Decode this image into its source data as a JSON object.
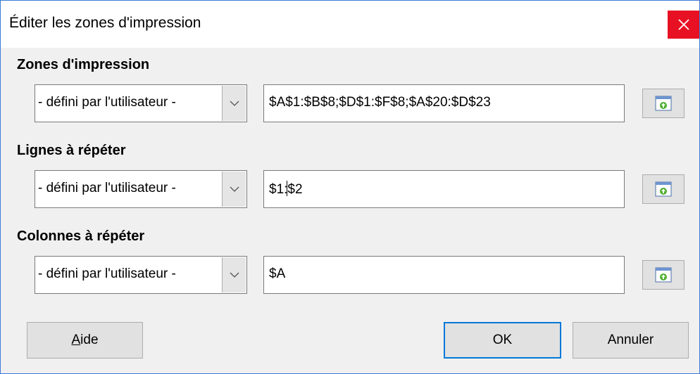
{
  "window": {
    "title": "Éditer les zones d'impression",
    "close_icon": "close-icon"
  },
  "sections": [
    {
      "label": "Zones d'impression",
      "combo_value": "- défini par l'utilisateur -",
      "field_value": "$A$1:$B$8;$D$1:$F$8;$A$20:$D$23"
    },
    {
      "label": "Lignes à répéter",
      "combo_value": "- défini par l'utilisateur -",
      "field_value_before_caret": "$1:",
      "field_value_after_caret": "$2"
    },
    {
      "label": "Colonnes à répéter",
      "combo_value": "- défini par l'utilisateur -",
      "field_value": "$A"
    }
  ],
  "buttons": {
    "help_mnemonic": "A",
    "help_rest": "ide",
    "ok": "OK",
    "cancel": "Annuler"
  },
  "colors": {
    "close_bg": "#e81123",
    "default_button_border": "#0078d7",
    "dialog_bg": "#f0f0f0"
  }
}
